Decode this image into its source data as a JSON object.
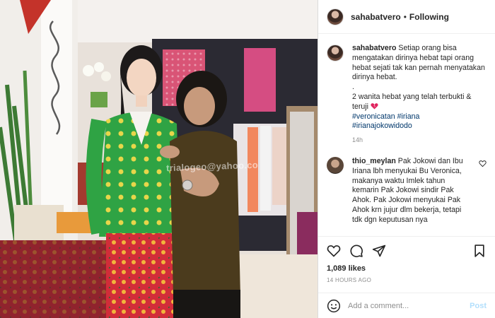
{
  "post": {
    "author": "sahabatvero",
    "follow_status": "Following",
    "separator": "•",
    "watermark": "trialogeo@yahoo.co",
    "caption": {
      "username": "sahabatvero",
      "text_1": "Setiap orang bisa mengatakan dirinya hebat tapi orang hebat sejati tak kan pernah menyatakan dirinya hebat.",
      "bullet": ".",
      "text_2": "2 wanita hebat yang telah terbukti & teruji",
      "hashtag_1": "#veronicatan",
      "hashtag_2": "#iriana",
      "hashtag_3": "#irianajokowidodo",
      "time": "14h"
    },
    "comment": {
      "username": "thio_meylan",
      "text": "Pak Jokowi dan Ibu Iriana lbh menyukai Bu Veronica, makanya waktu Imlek tahun kemarin Pak Jokowi sindir Pak Ahok. Pak Jokowi menyukai Pak Ahok krn jujur dlm bekerja, tetapi tdk dgn keputusan nya"
    },
    "likes": "1,089 likes",
    "posted_ago": "14 HOURS AGO",
    "add_comment_placeholder": "Add a comment...",
    "post_button": "Post"
  },
  "icons": {
    "like": "heart-icon",
    "comment": "comment-icon",
    "share": "send-icon",
    "save": "bookmark-icon",
    "emoji": "smiley-icon",
    "caption_emoji": "broken-heart-icon"
  },
  "colors": {
    "accent_link": "#00376b",
    "muted": "#8e8e8e",
    "post_disabled": "#b2dffc",
    "divider": "#efefef"
  }
}
